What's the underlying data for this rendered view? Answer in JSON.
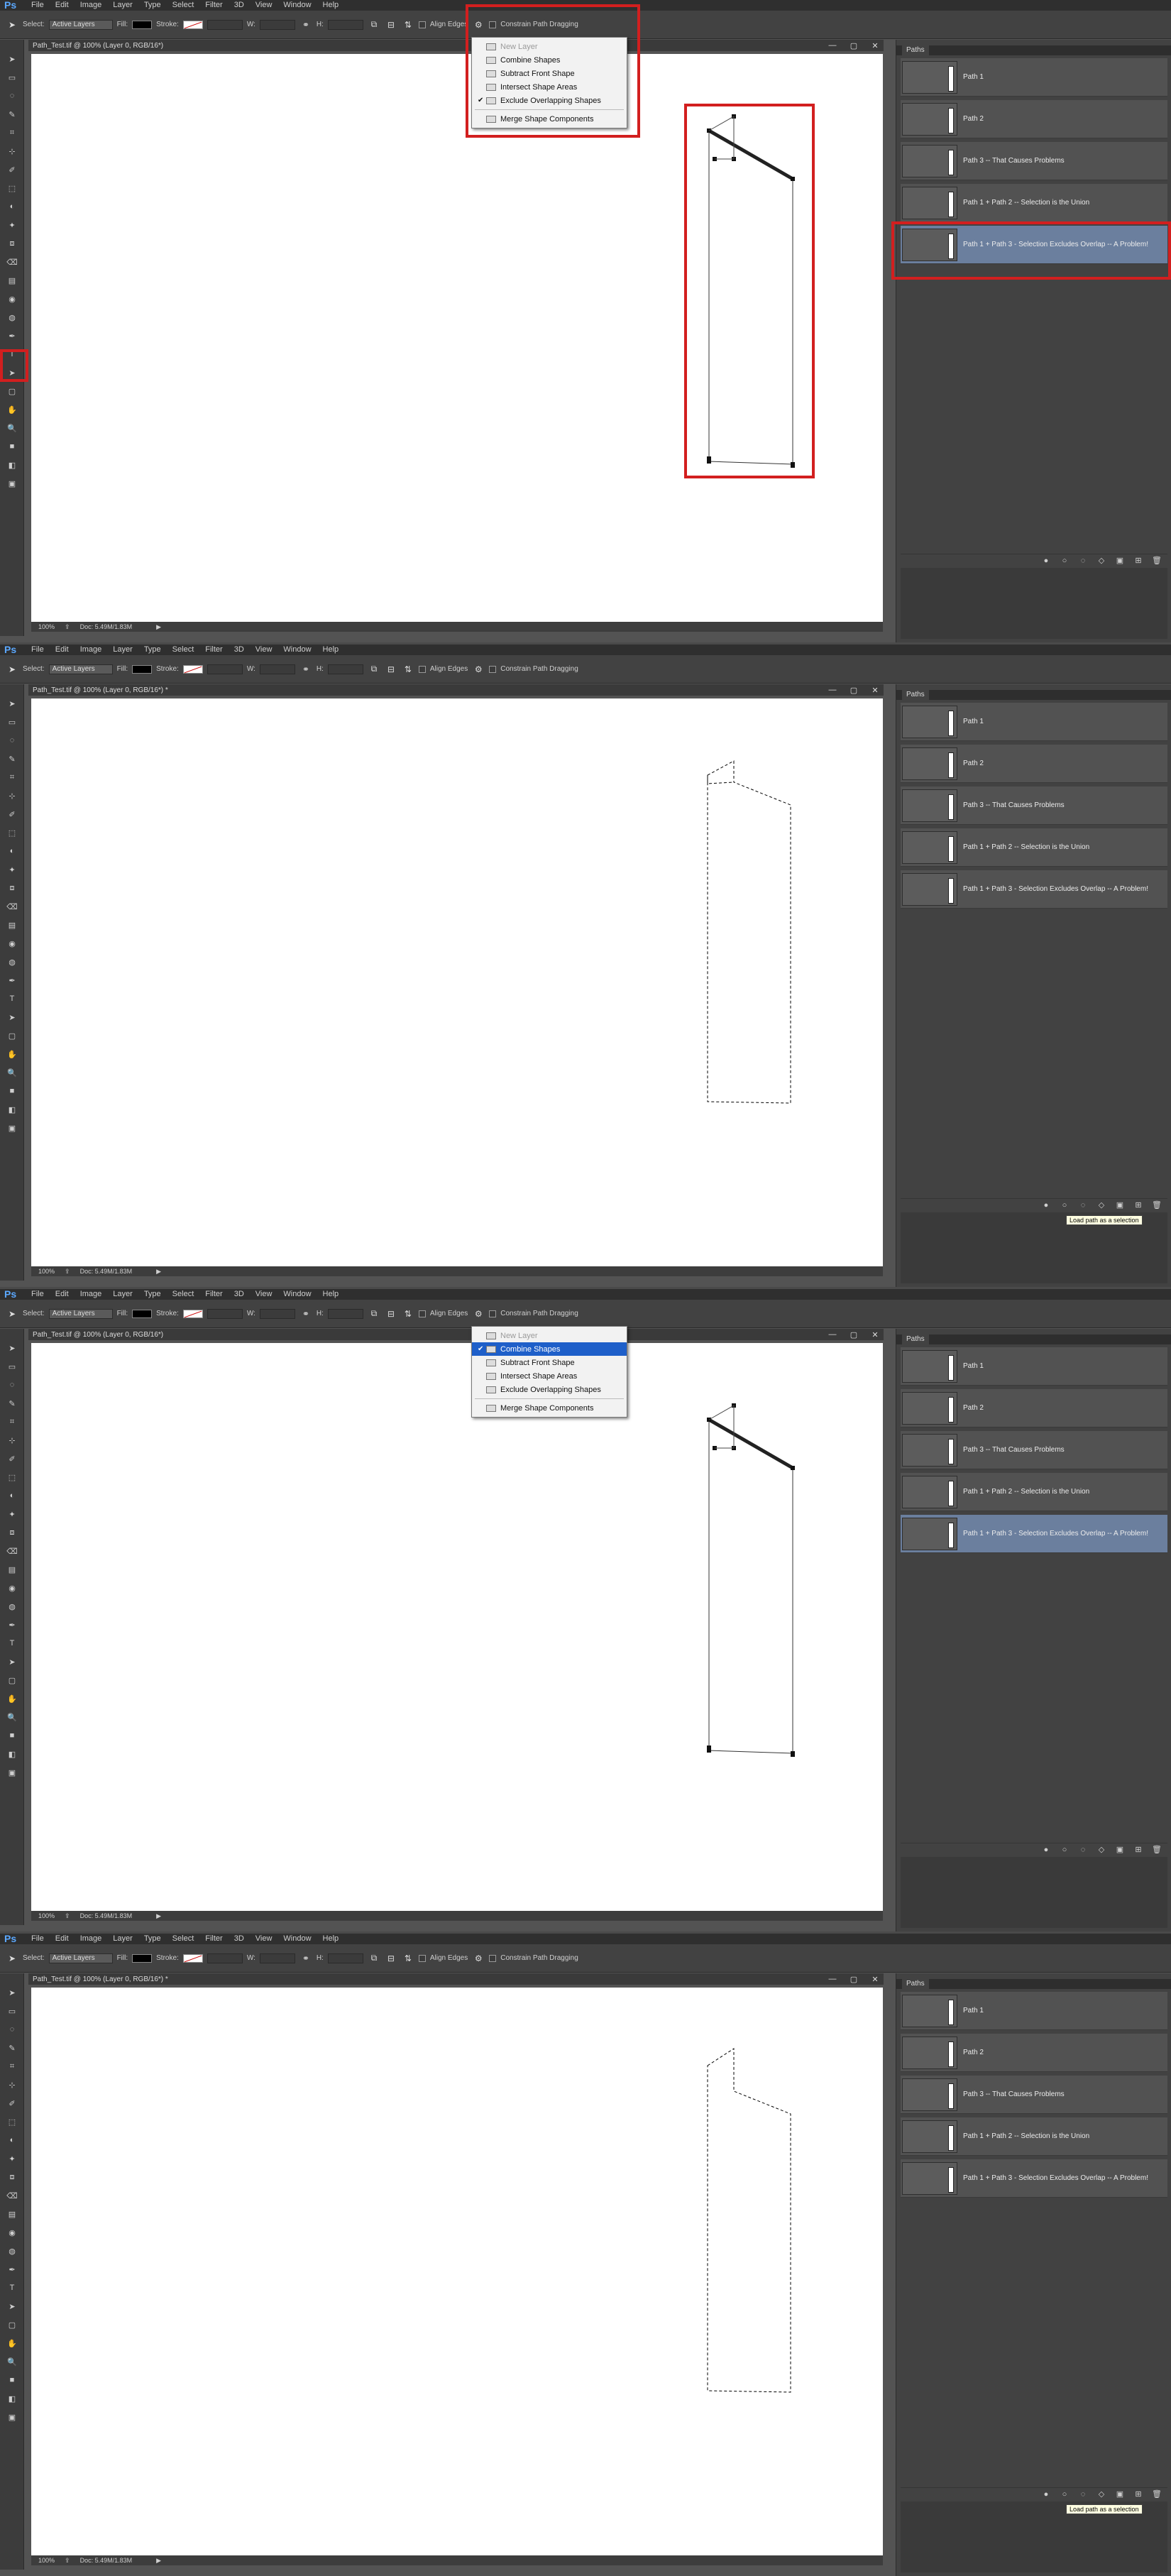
{
  "app": {
    "logo": "Ps",
    "menu": [
      "File",
      "Edit",
      "Image",
      "Layer",
      "Type",
      "Select",
      "Filter",
      "3D",
      "View",
      "Window",
      "Help"
    ]
  },
  "options_bar": {
    "select_label": "Select:",
    "select_value": "Active Layers",
    "fill_label": "Fill:",
    "stroke_label": "Stroke:",
    "w_label": "W:",
    "h_label": "H:",
    "align_edges": "Align Edges",
    "constrain": "Constrain Path Dragging"
  },
  "document": {
    "tab_title": "Path_Test.tif @ 100% (Layer 0, RGB/16*)",
    "tab_title_modified": "Path_Test.tif @ 100% (Layer 0, RGB/16*) *",
    "zoom": "100%",
    "doc_info": "Doc: 5.49M/1.83M"
  },
  "paths_panel": {
    "tab": "Paths",
    "items": [
      "Path 1",
      "Path 2",
      "Path 3 -- That Causes Problems",
      "Path 1 + Path 2 -- Selection is the Union",
      "Path 1 + Path 3 - Selection Excludes Overlap -- A Problem!"
    ],
    "tooltip": "Load path as a selection"
  },
  "shape_ops_menu": {
    "items": [
      "New Layer",
      "Combine Shapes",
      "Subtract Front Shape",
      "Intersect Shape Areas",
      "Exclude Overlapping Shapes",
      "Merge Shape Components"
    ]
  },
  "frames": [
    {
      "checked": "Exclude Overlapping Shapes",
      "highlighted": "",
      "selected_path": 4,
      "mode": "path",
      "tooltip": false
    },
    {
      "checked": "",
      "highlighted": "",
      "selected_path": -1,
      "mode": "selection_exclude",
      "tooltip": true
    },
    {
      "checked": "Combine Shapes",
      "highlighted": "Combine Shapes",
      "selected_path": 4,
      "mode": "path",
      "tooltip": false
    },
    {
      "checked": "",
      "highlighted": "",
      "selected_path": -1,
      "mode": "selection_union",
      "tooltip": true
    }
  ],
  "colors": {
    "highlight_box": "#d21f1f",
    "selected_row": "#6b7f9e",
    "menu_active": "#1e5fc9",
    "logo": "#5ba8ff"
  }
}
